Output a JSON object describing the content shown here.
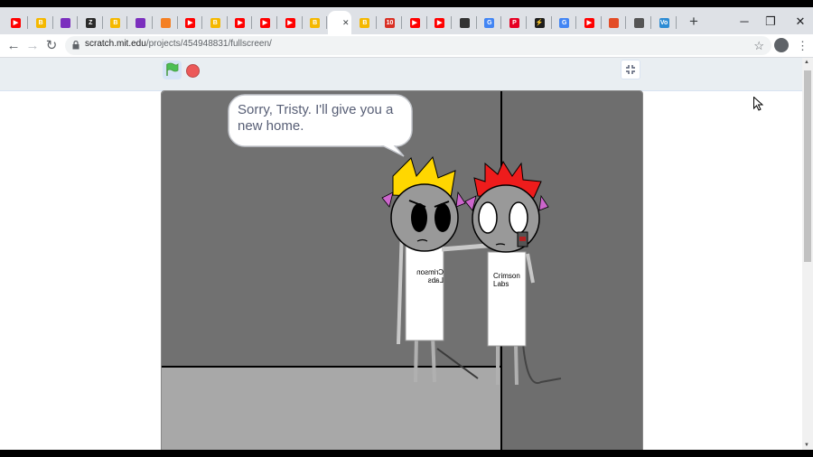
{
  "browser": {
    "tabs": [
      {
        "glyph": "▶",
        "color": "#ff0000"
      },
      {
        "glyph": "B",
        "color": "#f5b800"
      },
      {
        "glyph": "",
        "color": "#7b2fbe"
      },
      {
        "glyph": "Z",
        "color": "#2b2b2b"
      },
      {
        "glyph": "B",
        "color": "#f5b800"
      },
      {
        "glyph": "",
        "color": "#7b2fbe"
      },
      {
        "glyph": "",
        "color": "#f48024"
      },
      {
        "glyph": "▶",
        "color": "#ff0000"
      },
      {
        "glyph": "B",
        "color": "#f5b800"
      },
      {
        "glyph": "▶",
        "color": "#ff0000"
      },
      {
        "glyph": "▶",
        "color": "#ff0000"
      },
      {
        "glyph": "▶",
        "color": "#ff0000"
      },
      {
        "glyph": "B",
        "color": "#f5b800"
      },
      {
        "glyph": "",
        "color": "#ffffff",
        "active": true
      },
      {
        "glyph": "B",
        "color": "#f5b800"
      },
      {
        "glyph": "10",
        "color": "#d93025"
      },
      {
        "glyph": "▶",
        "color": "#ff0000"
      },
      {
        "glyph": "▶",
        "color": "#ff0000"
      },
      {
        "glyph": "",
        "color": "#333333"
      },
      {
        "glyph": "G",
        "color": "#4285f4"
      },
      {
        "glyph": "P",
        "color": "#e60023"
      },
      {
        "glyph": "⚡",
        "color": "#1e1e1e"
      },
      {
        "glyph": "G",
        "color": "#4285f4"
      },
      {
        "glyph": "▶",
        "color": "#ff0000"
      },
      {
        "glyph": "",
        "color": "#e34c26"
      },
      {
        "glyph": "",
        "color": "#555555"
      },
      {
        "glyph": "Vo",
        "color": "#2d8cd4"
      }
    ],
    "url_host": "scratch.mit.edu",
    "url_path": "/projects/454948831/fullscreen/"
  },
  "stage": {
    "bubble_text": "Sorry, Tristy. I'll give you a new home.",
    "shirt_left_text": "Crimson Labs",
    "shirt_right_text": "Crimson Labs"
  },
  "colors": {
    "wall": "#717171",
    "floor": "#a8a8a8",
    "crown_yellow": "#ffd700",
    "crown_red": "#ee1c1c",
    "ear_purple": "#cc66cc"
  }
}
